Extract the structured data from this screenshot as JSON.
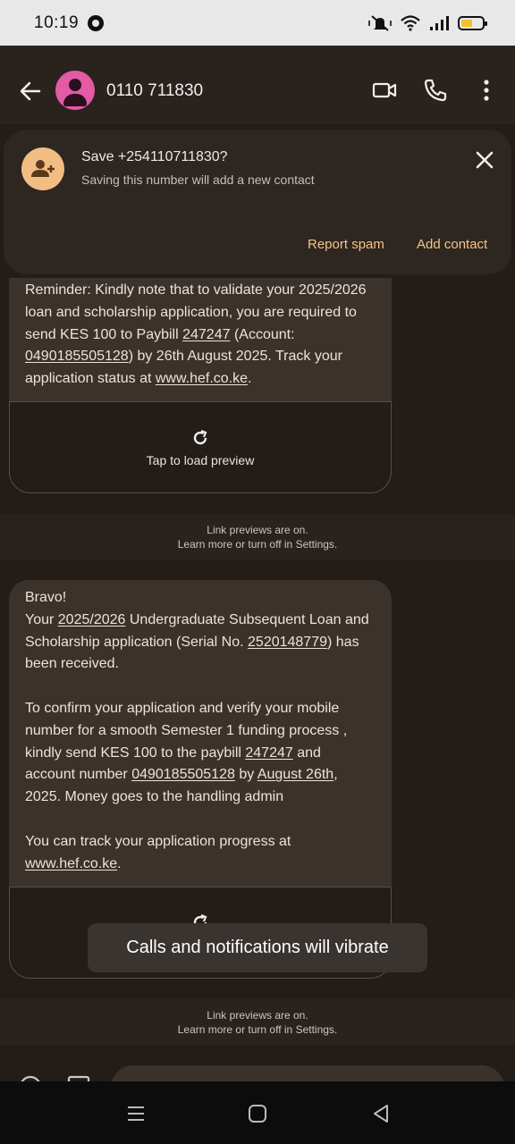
{
  "status_bar": {
    "time": "10:19"
  },
  "app_bar": {
    "title": "0110 711830"
  },
  "save_banner": {
    "title": "Save +254110711830?",
    "subtitle": "Saving this number will add a new contact",
    "report_spam": "Report spam",
    "add_contact": "Add contact"
  },
  "message1": {
    "parts": [
      "Reminder: Kindly note that to validate your 2025/2026",
      "loan and scholarship application, you are required to",
      "send KES 100 to Paybill ",
      "247247",
      " (Account:",
      "0490185505128",
      ") by 26th August 2025. Track your",
      "application status at ",
      "www.hef.co.ke",
      "."
    ],
    "preview_label": "Tap to load preview"
  },
  "link_note": {
    "line1": "Link previews are on.",
    "line2": "Learn more or turn off in Settings."
  },
  "message2": {
    "l1": "Bravo!",
    "l2a": "Your ",
    "l2b": "2025/2026",
    "l2c": " Undergraduate Subsequent Loan and",
    "l3a": "Scholarship application (Serial No. ",
    "l3b": "2520148779",
    "l3c": ") has",
    "l4": "been received.",
    "l5": "To confirm your application and verify your mobile",
    "l6": "number for a smooth Semester 1 funding process ,",
    "l7a": "kindly send KES 100 to the paybill ",
    "l7b": "247247",
    "l7c": " and",
    "l8a": "account number ",
    "l8b": "0490185505128",
    "l8c": " by ",
    "l8d": "August 26th",
    "l8e": ",",
    "l9": "2025. Money goes to the handling admin",
    "l10": "You can track your application progress at",
    "l11a": "www.hef.co.ke",
    "l11b": "."
  },
  "toast": {
    "text": "Calls and notifications will vibrate"
  },
  "colors": {
    "accent": "#f4c489",
    "avatar": "#e35aa5",
    "bubble": "#3b322c",
    "background": "#231c17"
  }
}
